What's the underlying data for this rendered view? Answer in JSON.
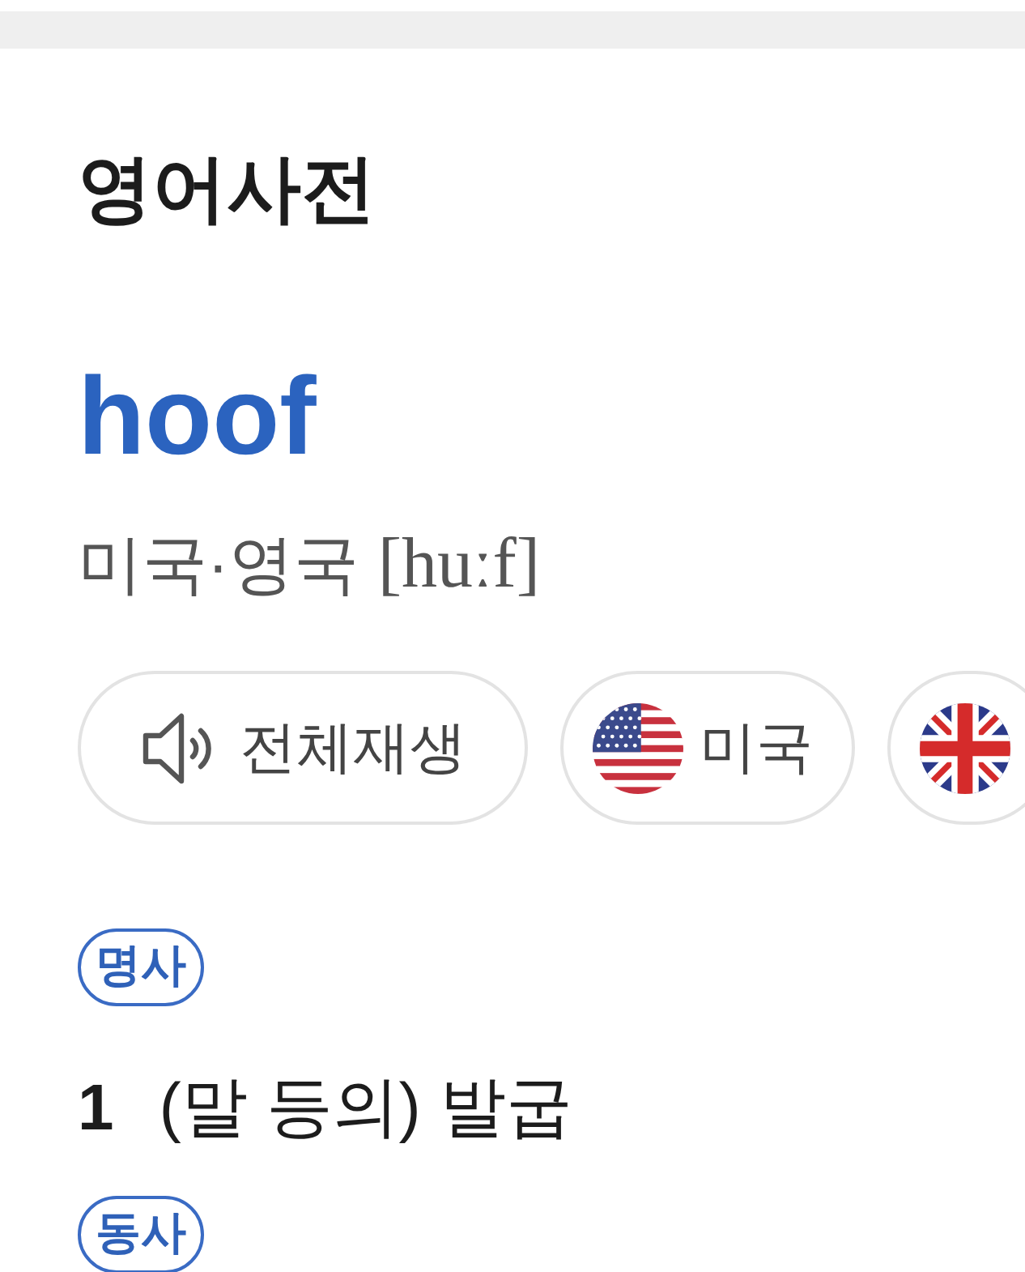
{
  "header": {
    "title": "영어사전"
  },
  "entry": {
    "word": "hoof",
    "pronunciation": {
      "region": "미국·영국",
      "phonetic": "[huːf]"
    }
  },
  "audio_buttons": [
    {
      "kind": "play_all",
      "label": "전체재생"
    },
    {
      "kind": "us_accent",
      "label": "미국"
    },
    {
      "kind": "uk_accent"
    }
  ],
  "senses": [
    {
      "part_of_speech": "명사",
      "definitions": [
        {
          "number": "1",
          "text": "(말 등의) 발굽"
        }
      ]
    },
    {
      "part_of_speech": "동사"
    }
  ]
}
